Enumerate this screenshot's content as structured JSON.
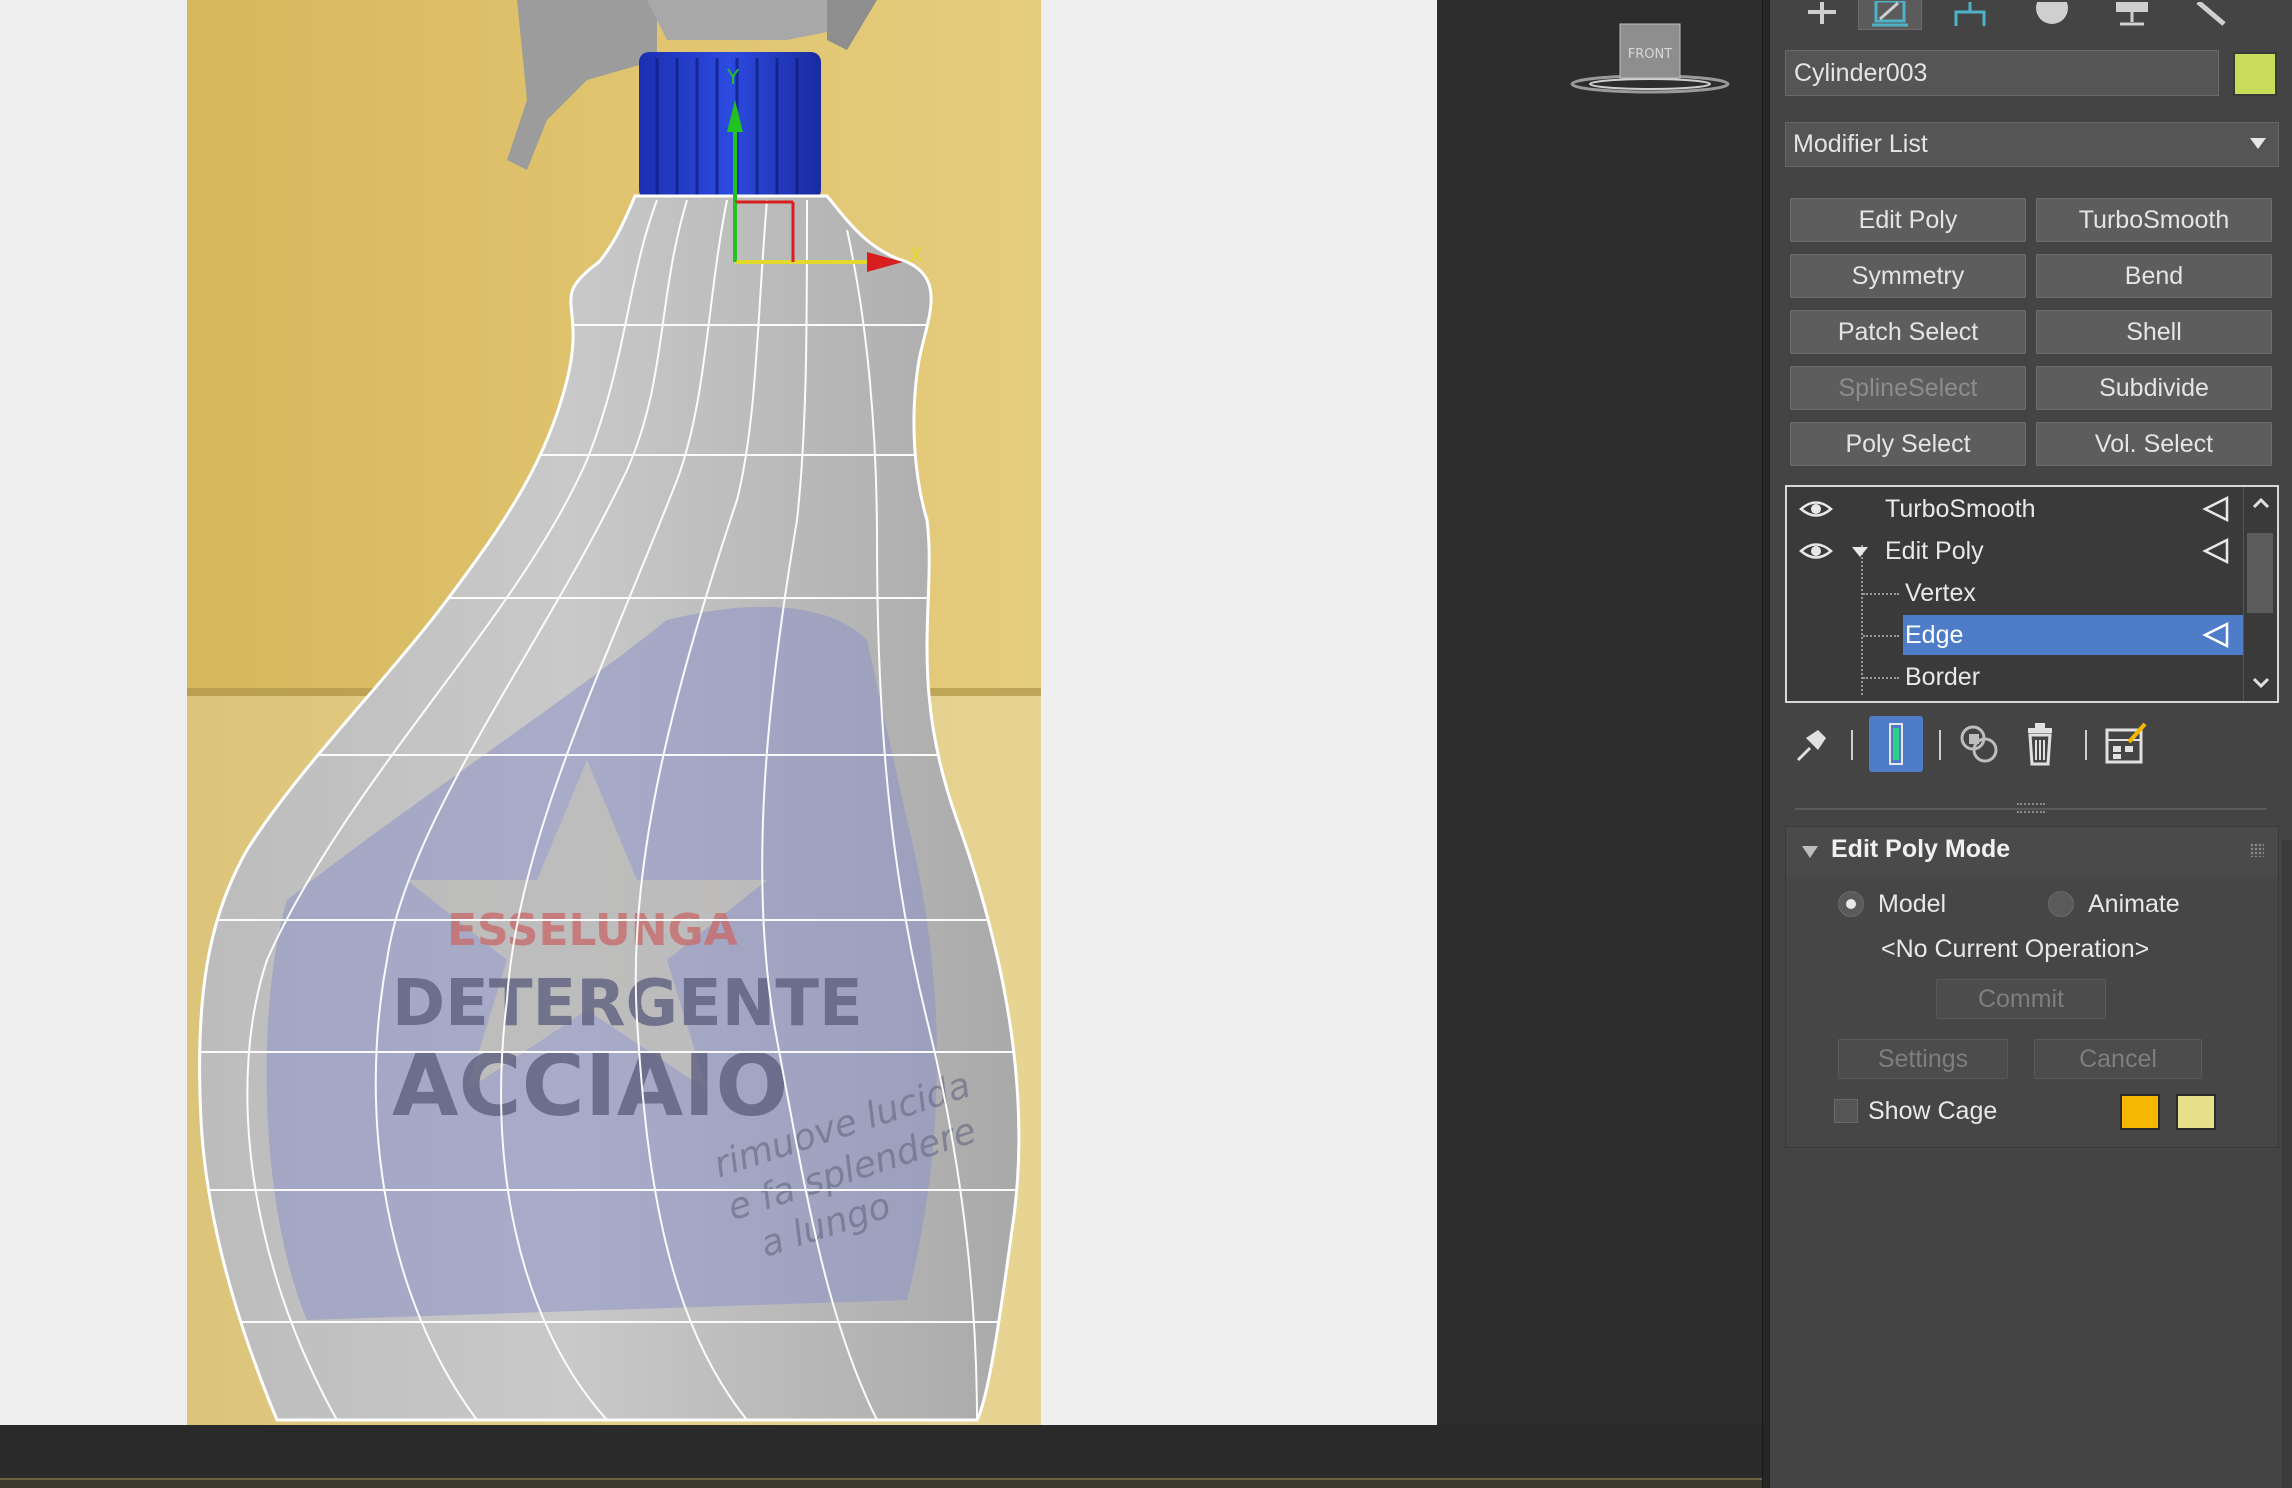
{
  "viewport": {
    "viewcube_label": "FRONT",
    "gizmo": {
      "x_axis": "X",
      "y_axis": "Y"
    },
    "photo_text": {
      "brand": "ESSELUNGA",
      "product_line1": "DETERGENTE",
      "product_line2": "ACCIAIO",
      "tagline_line1": "rimuove lucida",
      "tagline_line2": "e fa splendere",
      "tagline_line3": "a lungo"
    }
  },
  "command_panel": {
    "tabs": [
      {
        "name": "create-tab-icon"
      },
      {
        "name": "modify-tab-icon",
        "active": true
      },
      {
        "name": "hierarchy-tab-icon"
      },
      {
        "name": "motion-tab-icon"
      },
      {
        "name": "display-tab-icon"
      },
      {
        "name": "utilities-tab-icon"
      }
    ],
    "object_name": "Cylinder003",
    "object_color": "#c8dc5a",
    "modifier_list_label": "Modifier List",
    "modifier_buttons": [
      {
        "label": "Edit Poly",
        "enabled": true
      },
      {
        "label": "TurboSmooth",
        "enabled": true
      },
      {
        "label": "Symmetry",
        "enabled": true
      },
      {
        "label": "Bend",
        "enabled": true
      },
      {
        "label": "Patch Select",
        "enabled": true
      },
      {
        "label": "Shell",
        "enabled": true
      },
      {
        "label": "SplineSelect",
        "enabled": false
      },
      {
        "label": "Subdivide",
        "enabled": true
      },
      {
        "label": "Poly Select",
        "enabled": true
      },
      {
        "label": "Vol. Select",
        "enabled": true
      }
    ],
    "modifier_stack": [
      {
        "label": "TurboSmooth",
        "level": 0,
        "visible": true
      },
      {
        "label": "Edit Poly",
        "level": 0,
        "visible": true,
        "expanded": true
      },
      {
        "label": "Vertex",
        "level": 1
      },
      {
        "label": "Edge",
        "level": 1,
        "selected": true
      },
      {
        "label": "Border",
        "level": 1
      }
    ],
    "selection_color": "#4e7cc6",
    "stack_tools": [
      "pin-stack-icon",
      "show-end-result-icon",
      "make-unique-icon",
      "remove-modifier-icon",
      "configure-modifier-sets-icon"
    ],
    "edit_poly_mode": {
      "title": "Edit Poly Mode",
      "model_label": "Model",
      "animate_label": "Animate",
      "mode_selected": "Model",
      "current_operation": "<No Current Operation>",
      "commit_label": "Commit",
      "settings_label": "Settings",
      "cancel_label": "Cancel",
      "show_cage_label": "Show Cage",
      "show_cage_checked": false,
      "cage_colors": [
        "#f5b800",
        "#e6e08a"
      ]
    }
  }
}
